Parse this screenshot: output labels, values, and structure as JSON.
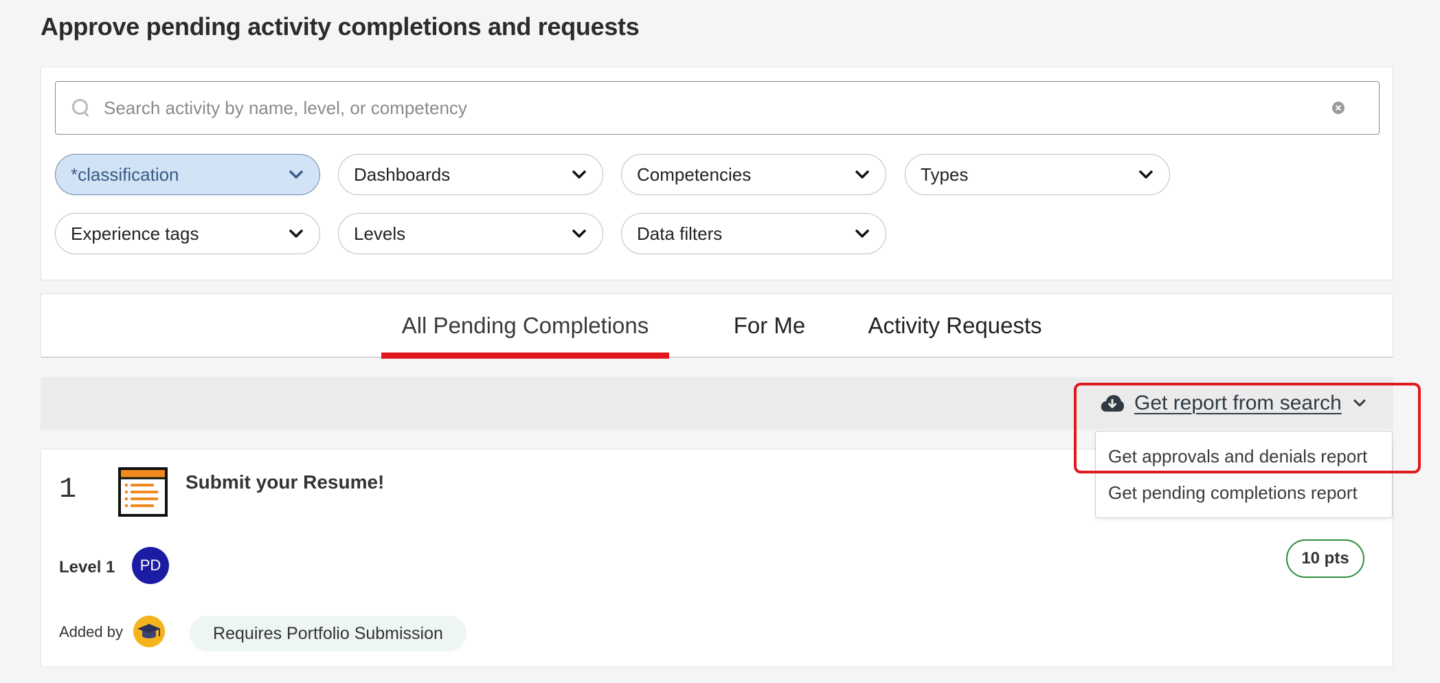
{
  "page": {
    "title": "Approve pending activity completions and requests"
  },
  "search": {
    "placeholder": "Search activity by name, level, or competency",
    "value": ""
  },
  "filters": [
    {
      "label": "*classification",
      "active": true
    },
    {
      "label": "Dashboards",
      "active": false
    },
    {
      "label": "Competencies",
      "active": false
    },
    {
      "label": "Types",
      "active": false
    },
    {
      "label": "Experience tags",
      "active": false
    },
    {
      "label": "Levels",
      "active": false
    },
    {
      "label": "Data filters",
      "active": false
    }
  ],
  "tabs": [
    {
      "label": "All Pending Completions",
      "active": true
    },
    {
      "label": "For Me",
      "active": false
    },
    {
      "label": "Activity Requests",
      "active": false
    }
  ],
  "report": {
    "toggle_label": "Get report from search",
    "menu": [
      {
        "label": "Get approvals and denials report"
      },
      {
        "label": "Get pending completions report"
      }
    ]
  },
  "activity": {
    "rank": "1",
    "title": "Submit your Resume!",
    "level": "Level 1",
    "avatar_initials": "PD",
    "points": "10 pts",
    "added_by_label": "Added by",
    "tag": "Requires Portfolio Submission"
  },
  "colors": {
    "accent_red": "#e0191e",
    "active_chip_bg": "#d3e3f6",
    "avatar_bg": "#1b1ba3",
    "points_border": "#2e8b3a"
  }
}
